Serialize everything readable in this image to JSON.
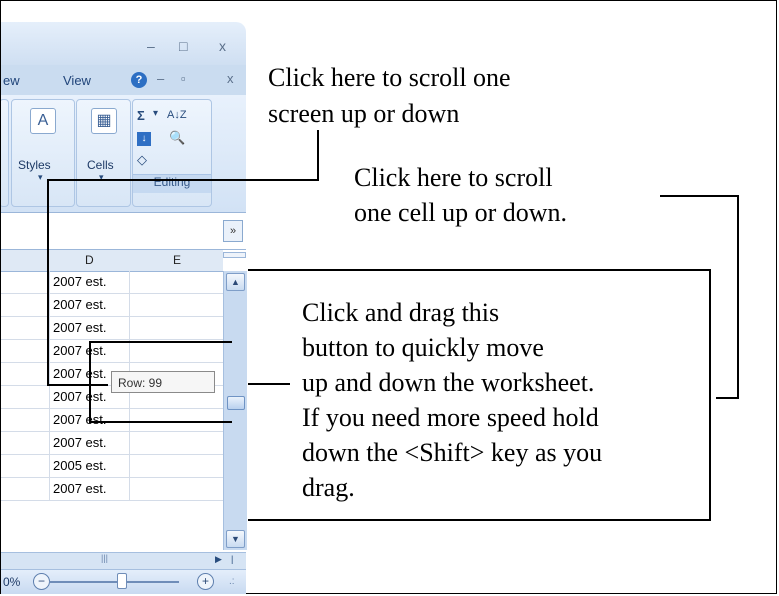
{
  "window": {
    "minimize_glyph": "–",
    "restore_glyph": "□",
    "close_glyph": "x"
  },
  "ribbon_tabs": {
    "partial_tab": "ew",
    "view_tab": "View",
    "help_glyph": "?",
    "minimize_glyph": "–",
    "restore_glyph": "▫",
    "close_glyph": "x"
  },
  "ribbon": {
    "styles_label": "Styles",
    "cells_label": "Cells",
    "editing_label": "Editing",
    "sum_glyph": "Σ",
    "sort_glyph": "A↓Z",
    "find_glyph": "🔍",
    "fill_glyph": "↓",
    "clear_glyph": "◇"
  },
  "formula_bar": {
    "expand_glyph": "»"
  },
  "columns": [
    "D",
    "E"
  ],
  "rows": [
    "2007 est.",
    "2007 est.",
    "2007 est.",
    "2007 est.",
    "2007 est.",
    "2007 est.",
    "2007 est.",
    "2007 est.",
    "2005 est.",
    "2007 est."
  ],
  "tooltip": "Row: 99",
  "status": {
    "zoom": "0%"
  },
  "annotations": {
    "page_scroll_line1": "Click here to scroll one",
    "page_scroll_line2": "screen up or down",
    "cell_scroll_line1": "Click here to scroll",
    "cell_scroll_line2": "one cell up or down.",
    "drag_line1": "Click and drag this",
    "drag_line2": "button to quickly move",
    "drag_line3": "up and down the worksheet.",
    "drag_line4": "If you need  more speed hold",
    "drag_line5": "down the  <Shift> key as you",
    "drag_line6": "drag."
  },
  "colors": {
    "ribbon_blue": "#cadcf0",
    "scrollbar_blue": "#c8daf0"
  }
}
